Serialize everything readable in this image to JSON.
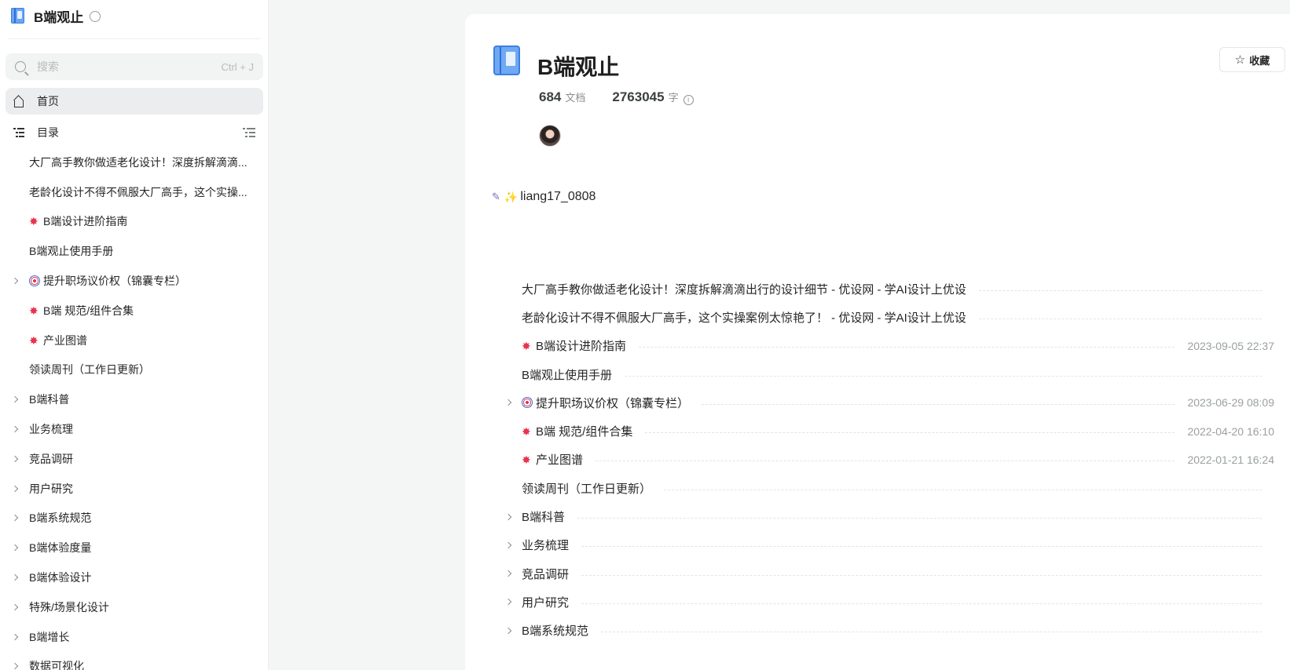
{
  "sidebar": {
    "title": "B端观止",
    "search_placeholder": "搜索",
    "search_shortcut": "Ctrl + J",
    "home_label": "首页",
    "toc_label": "目录",
    "items": [
      {
        "label": "大厂高手教你做适老化设计！深度拆解滴滴...",
        "icon": "",
        "expandable": false
      },
      {
        "label": "老龄化设计不得不佩服大厂高手，这个实操...",
        "icon": "",
        "expandable": false
      },
      {
        "label": "B端设计进阶指南",
        "icon": "burst",
        "expandable": false
      },
      {
        "label": "B端观止使用手册",
        "icon": "",
        "expandable": false
      },
      {
        "label": "提升职场议价权（锦囊专栏）",
        "icon": "target",
        "expandable": true
      },
      {
        "label": " B端 规范/组件合集",
        "icon": "burst",
        "expandable": false
      },
      {
        "label": " 产业图谱",
        "icon": "burst",
        "expandable": false
      },
      {
        "label": "领读周刊（工作日更新）",
        "icon": "",
        "expandable": false
      },
      {
        "label": "B端科普",
        "icon": "",
        "expandable": true
      },
      {
        "label": "业务梳理",
        "icon": "",
        "expandable": true
      },
      {
        "label": "竞品调研",
        "icon": "",
        "expandable": true
      },
      {
        "label": "用户研究",
        "icon": "",
        "expandable": true
      },
      {
        "label": "B端系统规范",
        "icon": "",
        "expandable": true
      },
      {
        "label": "B端体验度量",
        "icon": "",
        "expandable": true
      },
      {
        "label": "B端体验设计",
        "icon": "",
        "expandable": true
      },
      {
        "label": "特殊/场景化设计",
        "icon": "",
        "expandable": true
      },
      {
        "label": "B端增长",
        "icon": "",
        "expandable": true
      },
      {
        "label": "数据可视化",
        "icon": "",
        "expandable": true
      }
    ]
  },
  "main": {
    "title": "B端观止",
    "favorite_label": "收藏",
    "doc_count": "684",
    "doc_unit": "文档",
    "word_count": "2763045",
    "word_unit": "字",
    "intro_text": "liang17_0808",
    "catalog": [
      {
        "title": "大厂高手教你做适老化设计！深度拆解滴滴出行的设计细节 - 优设网 - 学AI设计上优设",
        "icon": "",
        "date": "",
        "expandable": false
      },
      {
        "title": "老龄化设计不得不佩服大厂高手，这个实操案例太惊艳了！ - 优设网 - 学AI设计上优设",
        "icon": "",
        "date": "",
        "expandable": false
      },
      {
        "title": "B端设计进阶指南",
        "icon": "burst",
        "date": "2023-09-05 22:37",
        "expandable": false
      },
      {
        "title": "B端观止使用手册",
        "icon": "",
        "date": "",
        "expandable": false
      },
      {
        "title": "提升职场议价权（锦囊专栏）",
        "icon": "target",
        "date": "2023-06-29 08:09",
        "expandable": true
      },
      {
        "title": " B端 规范/组件合集",
        "icon": "burst",
        "date": "2022-04-20 16:10",
        "expandable": false
      },
      {
        "title": " 产业图谱",
        "icon": "burst",
        "date": "2022-01-21 16:24",
        "expandable": false
      },
      {
        "title": "领读周刊（工作日更新）",
        "icon": "",
        "date": "",
        "expandable": false
      },
      {
        "title": "B端科普",
        "icon": "",
        "date": "",
        "expandable": true
      },
      {
        "title": "业务梳理",
        "icon": "",
        "date": "",
        "expandable": true
      },
      {
        "title": "竞品调研",
        "icon": "",
        "date": "",
        "expandable": true
      },
      {
        "title": "用户研究",
        "icon": "",
        "date": "",
        "expandable": true
      },
      {
        "title": "B端系统规范",
        "icon": "",
        "date": "",
        "expandable": true
      }
    ]
  },
  "colors": {
    "accent_blue": "#3d7fe0",
    "burst_red": "#e8344e",
    "background": "#f4f5f5"
  }
}
